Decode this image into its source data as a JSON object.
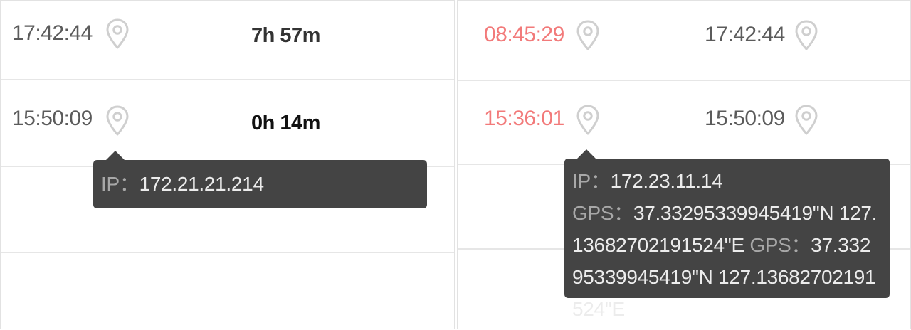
{
  "left_panel": {
    "rows": [
      {
        "time": "17:42:44",
        "pin_icon": "map-pin-icon",
        "duration": "7h 57m"
      },
      {
        "time": "15:50:09",
        "pin_icon": "map-pin-icon",
        "duration": "0h 14m"
      }
    ],
    "tooltip": {
      "ip_label": "IP",
      "separator": "：",
      "ip_value": "172.21.21.214"
    }
  },
  "right_panel": {
    "rows": [
      {
        "check_in": "08:45:29",
        "check_out": "17:42:44"
      },
      {
        "check_in": "15:36:01",
        "check_out": "15:50:09"
      }
    ],
    "tooltip": {
      "ip_label": "IP",
      "separator": "：",
      "ip_value": "172.23.11.14",
      "gps_label": "GPS",
      "gps_value_1": "37.33295339945419\"N 127.13682702191524\"E",
      "gps_value_2": "37.33295339945419\"N 127.13682702191524\"E"
    }
  },
  "colors": {
    "late_time": "#f27a7a",
    "tooltip_bg": "#444444",
    "tooltip_key": "#a8a8a8",
    "pin_stroke": "#cfcfcf"
  }
}
